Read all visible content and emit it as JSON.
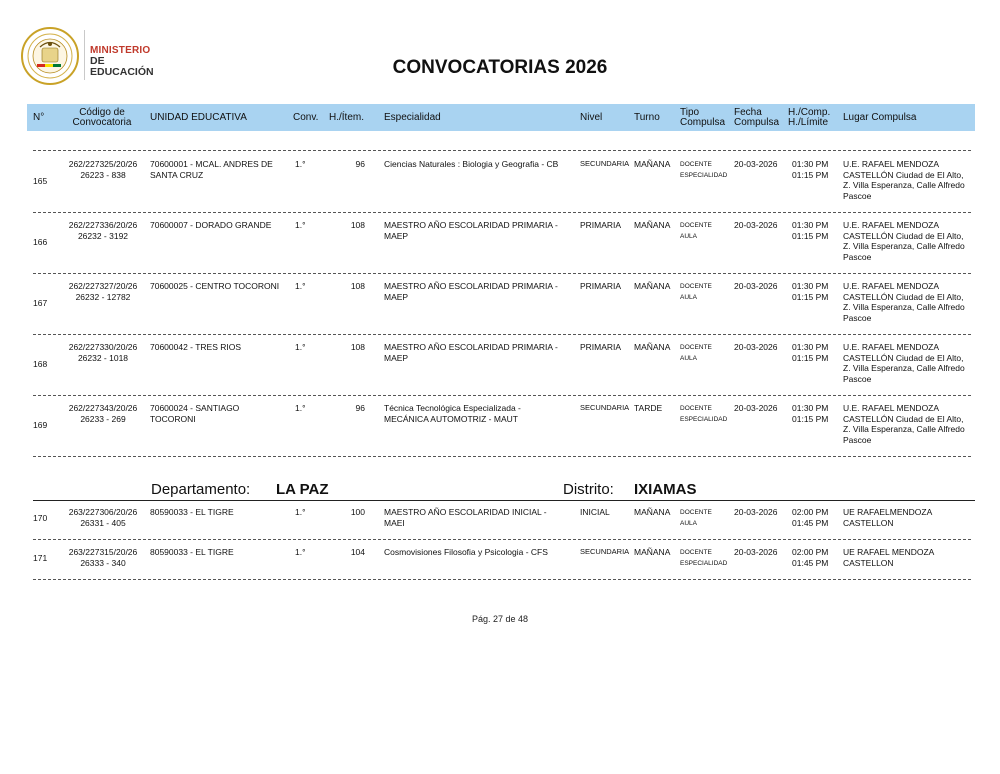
{
  "logo": {
    "line1": "MINISTERIO",
    "line2": "DE EDUCACIÓN"
  },
  "title": "CONVOCATORIAS 2026",
  "headers": {
    "n": "N°",
    "codigo_1": "Código de",
    "codigo_2": "Convocatoria",
    "unidad": "UNIDAD EDUCATIVA",
    "conv": "Conv.",
    "hitem": "H./Ítem.",
    "especialidad": "Especialidad",
    "nivel": "Nivel",
    "turno": "Turno",
    "tipo_1": "Tipo",
    "tipo_2": "Compulsa",
    "fecha_1": "Fecha",
    "fecha_2": "Compulsa",
    "hcomp_1": "H./Comp.",
    "hcomp_2": "H./Límite",
    "lugar": "Lugar Compulsa"
  },
  "rows": [
    {
      "n": "165",
      "codigo_1": "262/227325/20/26",
      "codigo_2": "26223 - 838",
      "unidad_1": "70600001 - MCAL. ANDRES DE",
      "unidad_2": "SANTA CRUZ",
      "conv": "1.°",
      "hitem": "96",
      "esp_1": "Ciencias Naturales : Biologia y Geografia - CB",
      "esp_2": "",
      "nivel": "SECUNDARIA",
      "turno": "MAÑANA",
      "tipo_1": "DOCENTE",
      "tipo_2": "ESPECIALIDAD",
      "fecha": "20-03-2026",
      "hora_1": "01:30 PM",
      "hora_2": "01:15 PM",
      "lugar_1": "U.E. RAFAEL MENDOZA",
      "lugar_2": "CASTELLÓN Ciudad de El Alto,",
      "lugar_3": "Z. Villa Esperanza, Calle Alfredo",
      "lugar_4": "Pascoe"
    },
    {
      "n": "166",
      "codigo_1": "262/227336/20/26",
      "codigo_2": "26232 - 3192",
      "unidad_1": "70600007 - DORADO GRANDE",
      "unidad_2": "",
      "conv": "1.°",
      "hitem": "108",
      "esp_1": "MAESTRO AÑO ESCOLARIDAD PRIMARIA -",
      "esp_2": "MAEP",
      "nivel": "PRIMARIA",
      "turno": "MAÑANA",
      "tipo_1": "DOCENTE",
      "tipo_2": "AULA",
      "fecha": "20-03-2026",
      "hora_1": "01:30 PM",
      "hora_2": "01:15 PM",
      "lugar_1": "U.E. RAFAEL MENDOZA",
      "lugar_2": "CASTELLÓN Ciudad de El Alto,",
      "lugar_3": "Z. Villa Esperanza, Calle Alfredo",
      "lugar_4": "Pascoe"
    },
    {
      "n": "167",
      "codigo_1": "262/227327/20/26",
      "codigo_2": "26232 - 12782",
      "unidad_1": "70600025 - CENTRO TOCORONI",
      "unidad_2": "",
      "conv": "1.°",
      "hitem": "108",
      "esp_1": "MAESTRO AÑO ESCOLARIDAD PRIMARIA -",
      "esp_2": "MAEP",
      "nivel": "PRIMARIA",
      "turno": "MAÑANA",
      "tipo_1": "DOCENTE",
      "tipo_2": "AULA",
      "fecha": "20-03-2026",
      "hora_1": "01:30 PM",
      "hora_2": "01:15 PM",
      "lugar_1": "U.E. RAFAEL MENDOZA",
      "lugar_2": "CASTELLÓN Ciudad de El Alto,",
      "lugar_3": "Z. Villa Esperanza, Calle Alfredo",
      "lugar_4": "Pascoe"
    },
    {
      "n": "168",
      "codigo_1": "262/227330/20/26",
      "codigo_2": "26232 - 1018",
      "unidad_1": "70600042 - TRES RIOS",
      "unidad_2": "",
      "conv": "1.°",
      "hitem": "108",
      "esp_1": "MAESTRO AÑO ESCOLARIDAD PRIMARIA -",
      "esp_2": "MAEP",
      "nivel": "PRIMARIA",
      "turno": "MAÑANA",
      "tipo_1": "DOCENTE",
      "tipo_2": "AULA",
      "fecha": "20-03-2026",
      "hora_1": "01:30 PM",
      "hora_2": "01:15 PM",
      "lugar_1": "U.E. RAFAEL MENDOZA",
      "lugar_2": "CASTELLÓN Ciudad de El Alto,",
      "lugar_3": "Z. Villa Esperanza, Calle Alfredo",
      "lugar_4": "Pascoe"
    },
    {
      "n": "169",
      "codigo_1": "262/227343/20/26",
      "codigo_2": "26233 - 269",
      "unidad_1": "70600024 - SANTIAGO",
      "unidad_2": "TOCORONI",
      "conv": "1.°",
      "hitem": "96",
      "esp_1": "Técnica Tecnológica Especializada -",
      "esp_2": "MECÁNICA AUTOMOTRIZ - MAUT",
      "nivel": "SECUNDARIA",
      "turno": "TARDE",
      "tipo_1": "DOCENTE",
      "tipo_2": "ESPECIALIDAD",
      "fecha": "20-03-2026",
      "hora_1": "01:30 PM",
      "hora_2": "01:15 PM",
      "lugar_1": "U.E. RAFAEL MENDOZA",
      "lugar_2": "CASTELLÓN Ciudad de El Alto,",
      "lugar_3": "Z. Villa Esperanza, Calle Alfredo",
      "lugar_4": "Pascoe"
    }
  ],
  "section": {
    "dept_label": "Departamento:",
    "dept_value": "LA PAZ",
    "dist_label": "Distrito:",
    "dist_value": "IXIAMAS"
  },
  "rows2": [
    {
      "n": "170",
      "codigo_1": "263/227306/20/26",
      "codigo_2": "26331 - 405",
      "unidad_1": "80590033 - EL TIGRE",
      "unidad_2": "",
      "conv": "1.°",
      "hitem": "100",
      "esp_1": "MAESTRO AÑO ESCOLARIDAD INICIAL -",
      "esp_2": "MAEI",
      "nivel": "INICIAL",
      "turno": "MAÑANA",
      "tipo_1": "DOCENTE",
      "tipo_2": "AULA",
      "fecha": "20-03-2026",
      "hora_1": "02:00 PM",
      "hora_2": "01:45 PM",
      "lugar_1": "UE RAFAELMENDOZA",
      "lugar_2": "CASTELLON",
      "lugar_3": "",
      "lugar_4": ""
    },
    {
      "n": "171",
      "codigo_1": "263/227315/20/26",
      "codigo_2": "26333 - 340",
      "unidad_1": "80590033 - EL TIGRE",
      "unidad_2": "",
      "conv": "1.°",
      "hitem": "104",
      "esp_1": "Cosmovisiones Filosofia y Psicologia - CFS",
      "esp_2": "",
      "nivel": "SECUNDARIA",
      "turno": "MAÑANA",
      "tipo_1": "DOCENTE",
      "tipo_2": "ESPECIALIDAD",
      "fecha": "20-03-2026",
      "hora_1": "02:00 PM",
      "hora_2": "01:45 PM",
      "lugar_1": "UE RAFAEL MENDOZA",
      "lugar_2": "CASTELLON",
      "lugar_3": "",
      "lugar_4": ""
    }
  ],
  "footer": "Pág. 27 de 48",
  "colors": {
    "header_bg": "#a9d3f1",
    "brand_red": "#c0392b"
  }
}
